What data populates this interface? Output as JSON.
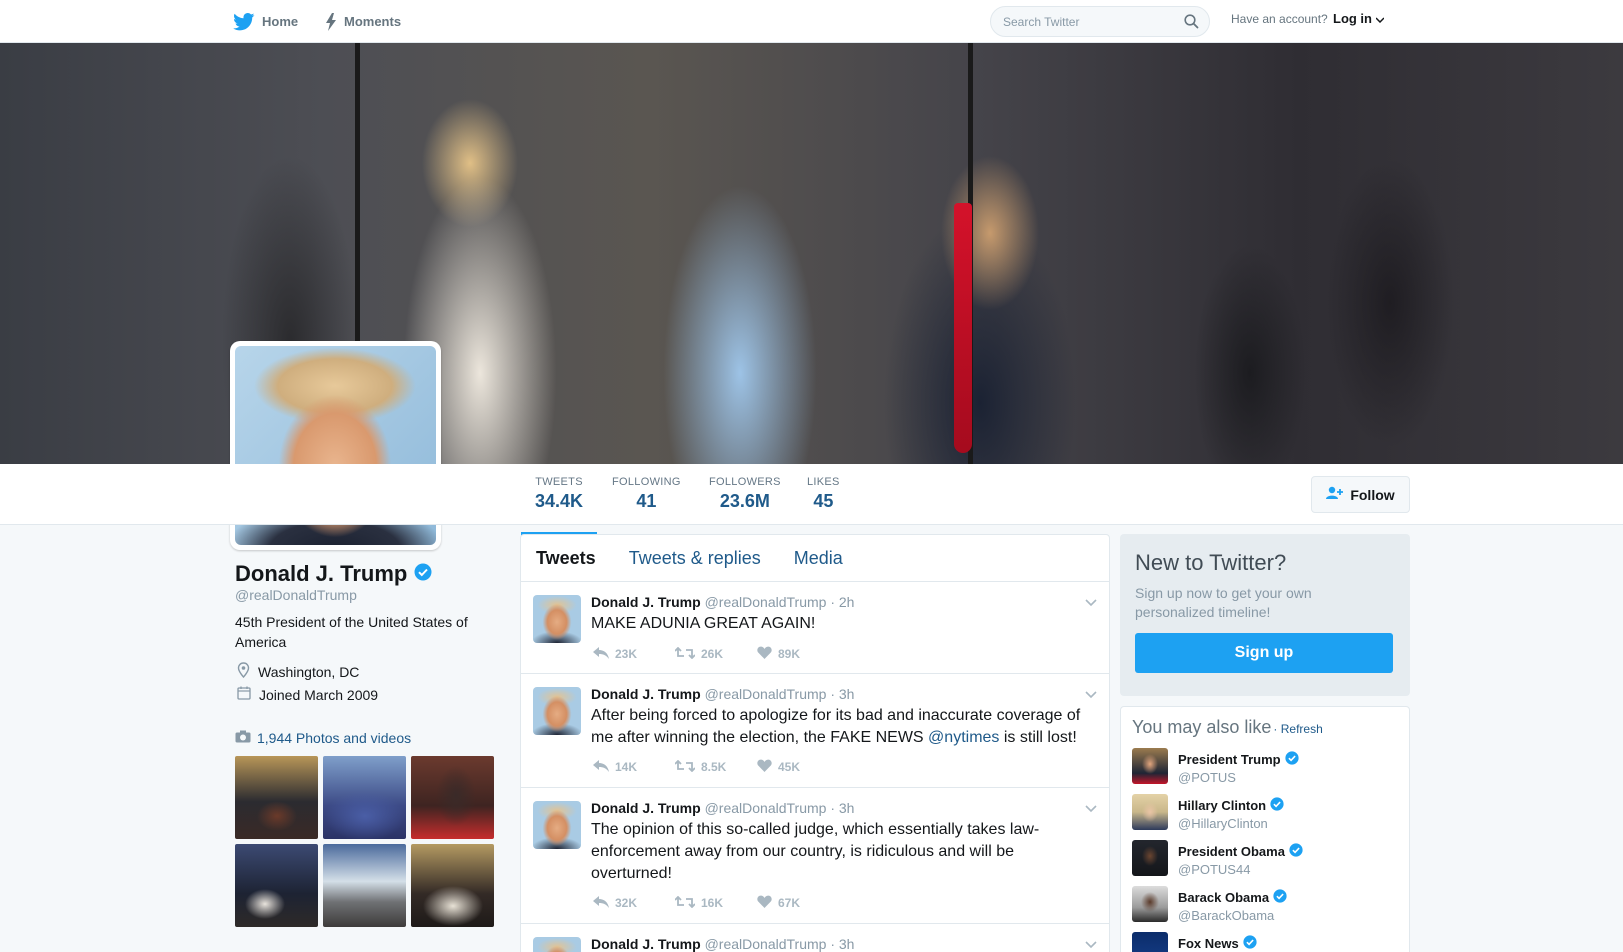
{
  "nav": {
    "home_label": "Home",
    "moments_label": "Moments",
    "search_placeholder": "Search Twitter",
    "have_account": "Have an account?",
    "login_label": "Log in"
  },
  "profile": {
    "name": "Donald J. Trump",
    "handle": "@realDonaldTrump",
    "bio": "45th President of the United States of America",
    "location": "Washington, DC",
    "joined": "Joined March 2009",
    "photos_videos": "1,944 Photos and videos"
  },
  "stats": [
    {
      "label": "TWEETS",
      "value": "34.4K"
    },
    {
      "label": "FOLLOWING",
      "value": "41"
    },
    {
      "label": "FOLLOWERS",
      "value": "23.6M"
    },
    {
      "label": "LIKES",
      "value": "45"
    }
  ],
  "follow_label": "Follow",
  "tabs": [
    "Tweets",
    "Tweets & replies",
    "Media"
  ],
  "tweets": [
    {
      "name": "Donald J. Trump",
      "handle": "@realDonaldTrump",
      "time": "· 2h",
      "text": "MAKE ADUNIA GREAT AGAIN!",
      "mention": "",
      "text_after": "",
      "replies": "23K",
      "retweets": "26K",
      "likes": "89K"
    },
    {
      "name": "Donald J. Trump",
      "handle": "@realDonaldTrump",
      "time": "· 3h",
      "text": "After being forced to apologize for its bad and inaccurate coverage of me after winning the election, the FAKE NEWS ",
      "mention": "@nytimes",
      "text_after": " is still lost!",
      "replies": "14K",
      "retweets": "8.5K",
      "likes": "45K"
    },
    {
      "name": "Donald J. Trump",
      "handle": "@realDonaldTrump",
      "time": "· 3h",
      "text": "The opinion of this so-called judge, which essentially takes law-enforcement away from our country, is ridiculous and will be overturned!",
      "mention": "",
      "text_after": "",
      "replies": "32K",
      "retweets": "16K",
      "likes": "67K"
    },
    {
      "name": "Donald J. Trump",
      "handle": "@realDonaldTrump",
      "time": "· 3h",
      "text": "",
      "mention": "",
      "text_after": "",
      "replies": "",
      "retweets": "",
      "likes": ""
    }
  ],
  "signup": {
    "title": "New to Twitter?",
    "subtitle": "Sign up now to get your own personalized timeline!",
    "button": "Sign up"
  },
  "suggestions": {
    "title": "You may also like",
    "refresh": "· Refresh",
    "items": [
      {
        "name": "President Trump",
        "handle": "@POTUS"
      },
      {
        "name": "Hillary Clinton",
        "handle": "@HillaryClinton"
      },
      {
        "name": "President Obama",
        "handle": "@POTUS44"
      },
      {
        "name": "Barack Obama",
        "handle": "@BarackObama"
      },
      {
        "name": "Fox News",
        "handle": ""
      }
    ]
  },
  "colors": {
    "accent": "#1da1f2",
    "link": "#1f5a8a",
    "verified": "#1da1f2"
  }
}
